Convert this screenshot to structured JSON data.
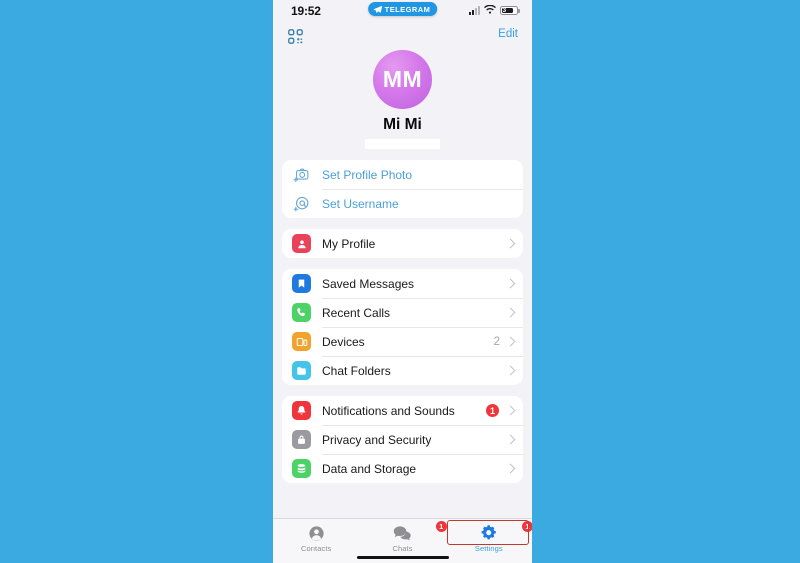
{
  "background": {
    "color": "#3aaae0"
  },
  "statusbar": {
    "time": "19:52",
    "app_pill_label": "TELEGRAM",
    "battery_level": "3",
    "icons": {
      "signal": "signal-icon",
      "wifi": "wifi-icon",
      "battery": "battery-icon"
    }
  },
  "header": {
    "qr_icon": "qr-code-icon",
    "edit_label": "Edit"
  },
  "profile": {
    "avatar_initials": "MM",
    "name": "Mi Mi",
    "phone_redacted": ""
  },
  "groups": [
    {
      "rows": [
        {
          "label": "Set Profile Photo",
          "icon": "camera-plus-icon",
          "style": "link",
          "value": "",
          "chevron": false,
          "badge": ""
        },
        {
          "label": "Set Username",
          "icon": "at-plus-icon",
          "style": "link",
          "value": "",
          "chevron": false,
          "badge": ""
        }
      ]
    },
    {
      "rows": [
        {
          "label": "My Profile",
          "icon": "person-badge-icon",
          "style": "normal",
          "value": "",
          "chevron": true,
          "badge": "",
          "icon_color": "#e8435a"
        }
      ]
    },
    {
      "rows": [
        {
          "label": "Saved Messages",
          "icon": "bookmark-icon",
          "style": "normal",
          "value": "",
          "chevron": true,
          "badge": "",
          "icon_color": "#1f7ae0"
        },
        {
          "label": "Recent Calls",
          "icon": "phone-icon",
          "style": "normal",
          "value": "",
          "chevron": true,
          "badge": "",
          "icon_color": "#4cd267"
        },
        {
          "label": "Devices",
          "icon": "devices-icon",
          "style": "normal",
          "value": "2",
          "chevron": true,
          "badge": "",
          "icon_color": "#f0a32e"
        },
        {
          "label": "Chat Folders",
          "icon": "folder-icon",
          "style": "normal",
          "value": "",
          "chevron": true,
          "badge": "",
          "icon_color": "#43c4e8"
        }
      ]
    },
    {
      "rows": [
        {
          "label": "Notifications and Sounds",
          "icon": "bell-icon",
          "style": "normal",
          "value": "",
          "chevron": true,
          "badge": "1",
          "icon_color": "#f1343c"
        },
        {
          "label": "Privacy and Security",
          "icon": "lock-icon",
          "style": "normal",
          "value": "",
          "chevron": true,
          "badge": "",
          "icon_color": "#9a9aa0"
        },
        {
          "label": "Data and Storage",
          "icon": "database-icon",
          "style": "normal",
          "value": "",
          "chevron": true,
          "badge": "",
          "icon_color": "#4cd267"
        }
      ]
    }
  ],
  "tabbar": {
    "tabs": [
      {
        "label": "Contacts",
        "icon": "person-circle-icon",
        "badge": "",
        "active": false
      },
      {
        "label": "Chats",
        "icon": "chat-bubbles-icon",
        "badge": "1",
        "active": false
      },
      {
        "label": "Settings",
        "icon": "gears-icon",
        "badge": "1",
        "active": true
      }
    ],
    "highlight_color": "#c0392b"
  }
}
